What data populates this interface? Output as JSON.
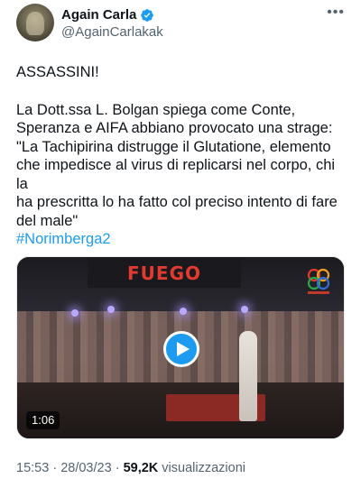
{
  "user": {
    "display_name": "Again Carla",
    "handle": "@AgainCarlakak",
    "verified": true
  },
  "menu": {
    "more_label": "•••"
  },
  "tweet": {
    "line1": "ASSASSINI!",
    "body": "La Dott.ssa L. Bolgan spiega come Conte,\nSperanza e AIFA abbiano provocato una strage:\n\"La Tachipirina distrugge il Glutatione, elemento\nche impedisce al virus di replicarsi nel corpo, chi la\nha prescritta lo ha fatto col preciso intento di fare\ndel male\"",
    "hashtag": "#Norimberga2"
  },
  "media": {
    "banner_text": "FUEGO",
    "duration": "1:06"
  },
  "meta": {
    "time": "15:53",
    "separator": "·",
    "date": "28/03/23",
    "views_count": "59,2K",
    "views_label": "visualizzazioni"
  },
  "colors": {
    "accent": "#1d9bf0",
    "text_primary": "#0f1419",
    "text_secondary": "#536471"
  }
}
